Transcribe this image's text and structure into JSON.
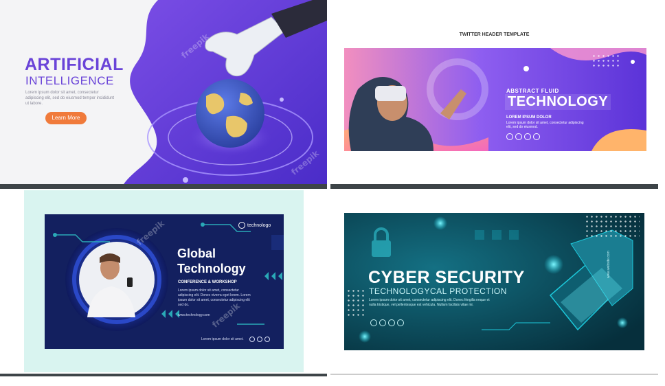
{
  "ai": {
    "title": "ARTIFICIAL",
    "subtitle": "INTELLIGENCE",
    "body": "Lorem ipsum dolor sit amet, consectetur adipiscing elit, sed do eiusmod tempor incididunt ut labore.",
    "button": "Learn More",
    "watermark": "freepik"
  },
  "vr": {
    "header": "TWITTER HEADER TEMPLATE",
    "kicker": "ABSTRACT FLUID",
    "title": "TECHNOLOGY",
    "tagline": "LOREM IPSUM DOLOR",
    "body": "Lorem ipsum dolor sit amet, consectetur adipiscing elit, sed do eiusmod."
  },
  "gt": {
    "brand": "technologo",
    "title1": "Global",
    "title2": "Technology",
    "subtitle": "CONFERENCE & WORKSHOP",
    "body": "Lorem ipsum dolor sit amet, consectetur adipiscing elit. Donec viverra eget lorem. Lorem ipsum dolor sit amet, consectetur adipiscing elit sed do.",
    "url": "www.technology.com",
    "footer": "Lorem ipsum dolor sit amet.",
    "watermark": "freepik"
  },
  "cs": {
    "title": "CYBER SECURITY",
    "subtitle": "TECHNOLOGYCAL PROTECTION",
    "body": "Lorem ipsum dolor sit amet, consectetur adipiscing elit. Donec fringilla neque et nulla tristique, vel pellentesque est vehicula. Nullam facilisis vitae mi.",
    "site": "www.website.com"
  }
}
